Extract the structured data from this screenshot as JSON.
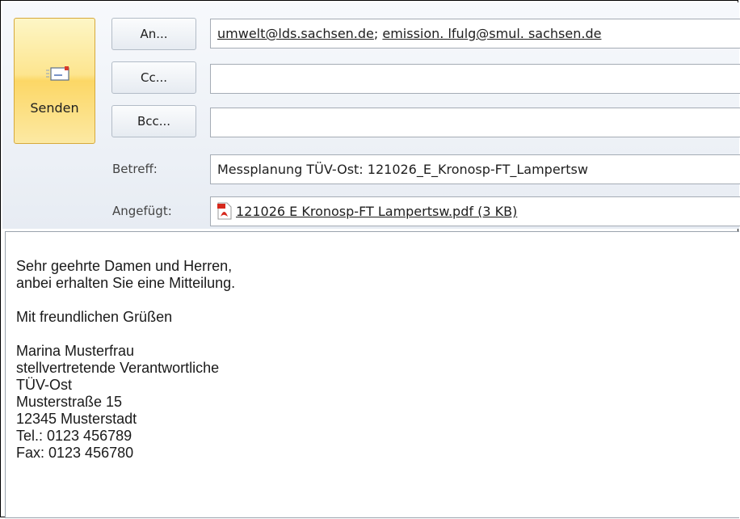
{
  "send": {
    "label": "Senden",
    "icon": "envelope-send-icon"
  },
  "buttons": {
    "to": "An...",
    "cc": "Cc...",
    "bcc": "Bcc..."
  },
  "fields": {
    "to": [
      "umwelt@lds.sachsen.de",
      "emission. lfulg@smul. sachsen.de"
    ],
    "to_separator": ";",
    "cc": "",
    "bcc": "",
    "subject_label": "Betreff:",
    "subject": "Messplanung TÜV-Ost: 121026_E_Kronosp-FT_Lampertsw",
    "attached_label": "Angefügt:",
    "attachment": "121026 E Kronosp-FT Lampertsw.pdf (3 KB)",
    "attachment_icon": "pdf-file-icon"
  },
  "body": {
    "lines": [
      "Sehr geehrte Damen und Herren,",
      "anbei erhalten Sie eine Mitteilung.",
      "",
      "Mit freundlichen Grüßen",
      "",
      "Marina Musterfrau",
      "stellvertretende Verantwortliche",
      "TÜV-Ost",
      "Musterstraße 15",
      "12345 Musterstadt",
      "Tel.:  0123 456789",
      "Fax:  0123 456780"
    ]
  },
  "colors": {
    "send_button": "#fcd766",
    "link": "#1e1e1e"
  }
}
